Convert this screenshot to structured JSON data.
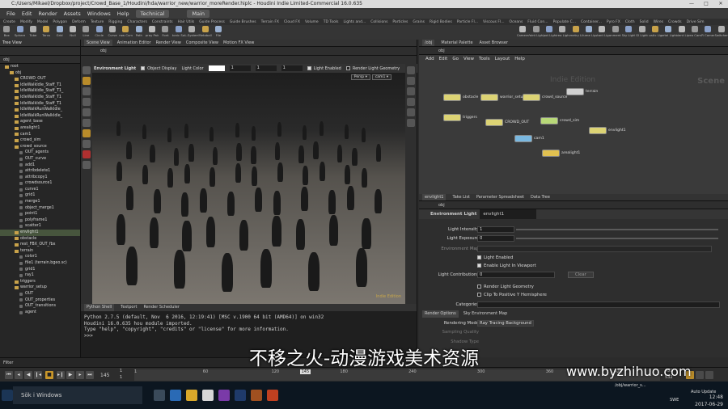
{
  "window": {
    "title": "C:/Users/Mikael/Dropbox/project/Crowd_Base_1/Houdini/hda/warrior_new/warrior_moreRender.hiplc - Houdini Indie Limited-Commercial 16.0.635",
    "controls": [
      "—",
      "□",
      "✕"
    ]
  },
  "menu": {
    "items": [
      "File",
      "Edit",
      "Render",
      "Assets",
      "Windows",
      "Help"
    ],
    "desktop": "Technical",
    "context": "Main"
  },
  "shelf": {
    "tabs": [
      "Create",
      "Modify",
      "Model",
      "Polygon",
      "Deform",
      "Texture",
      "Rigging",
      "Characters",
      "Constraints",
      "Hair Utils",
      "Guide Process",
      "Guide Brushes",
      "Terrain FX",
      "Cloud FX",
      "Volume",
      "TD Tools",
      "Lights and...",
      "Collisions",
      "Particles",
      "Grains",
      "Rigid Bodies",
      "Particle Fl...",
      "Viscous Fl...",
      "Oceans",
      "Fluid Con...",
      "Populate C...",
      "Container...",
      "Pyro FX",
      "Cloth",
      "Solid",
      "Wires",
      "Crowds",
      "Drive Sim"
    ],
    "tools": [
      "Box",
      "Sphere",
      "Tube",
      "Torus",
      "Grid",
      "Null",
      "Line",
      "Circle",
      "Curve",
      "Draw Curve",
      "Path",
      "Spray Paint",
      "Font",
      "Platonic Solids",
      "L-System",
      "Metaball",
      "File",
      "Camera",
      "Point Light",
      "Spot Light",
      "Area Light",
      "Geometry Light",
      "Volume Light",
      "Distant Light",
      "Environment Light",
      "Sky Light",
      "GI Light",
      "Caustic Light",
      "Portal Light",
      "Ambient Light",
      "Stereo Camera",
      "VR Camera",
      "Switcher"
    ]
  },
  "left": {
    "tab": "Tree View",
    "path": "obj",
    "tree": [
      "root",
      "obj",
      "CROWD_OUT",
      "IdleWalkIdle_Staff_T1",
      "IdleWalkIdle_Staff_T1_",
      "IdleWalkIdle_Staff_T1",
      "IdleWalkIdle_Staff_T1",
      "IdleWalkRunWalkIdle_",
      "IdleWalkRunWalkIdle_",
      "agent_base",
      "arealight1",
      "cam1",
      "crowd_sim",
      "crowd_source",
      "OUT_agents",
      "OUT_curve",
      "add1",
      "attribdelete1",
      "attribcopy1",
      "crowdsource1",
      "curve1",
      "grid1",
      "merge1",
      "object_merge1",
      "point1",
      "polyframe1",
      "scatter1",
      "envlight1",
      "obstacle",
      "rest_FBX_OUT_fbx",
      "terrain",
      "color1",
      "file1 (terrain.bgeo.sc)",
      "grid1",
      "ray1",
      "triggers",
      "warrior_setup",
      "OUT",
      "OUT_properties",
      "OUT_transitions",
      "agent"
    ],
    "filter": "Filter"
  },
  "viewer": {
    "tabs": [
      "Scene View",
      "Animation Editor",
      "Render View",
      "Composite View",
      "Motion FX View"
    ],
    "path": "obj",
    "node_type": "Environment Light",
    "object_display": "Object Display",
    "light_color": "Light Color",
    "color_vals": [
      "1",
      "1",
      "1"
    ],
    "light_enabled": "Light Enabled",
    "render_light_geo": "Render Light Geometry",
    "persp": "Persp ▾",
    "cam": "cam1 ▾",
    "edition": "Indie Edition"
  },
  "python": {
    "tabs": [
      "Python Shell",
      "Textport",
      "Render Scheduler"
    ],
    "lines": [
      "Python 2.7.5 (default, Nov  6 2016, 12:19:41) [MSC v.1900 64 bit (AMD64)] on win32",
      "Houdini 16.0.635 hou module imported.",
      "Type \"help\", \"copyright\", \"credits\" or \"license\" for more information.",
      ">>>"
    ]
  },
  "network": {
    "tabs": [
      "/obj",
      "Material Palette",
      "Asset Browser"
    ],
    "path": "obj",
    "menu": [
      "Add",
      "Edit",
      "Go",
      "View",
      "Tools",
      "Layout",
      "Help"
    ],
    "watermark": "Indie Edition",
    "context": "Scene",
    "nodes": [
      "obstacle",
      "warrior_setup",
      "crowd_source",
      "terrain",
      "triggers",
      "CROWD_OUT",
      "crowd_sim",
      "envlight1",
      "cam1",
      "arealight1"
    ]
  },
  "params": {
    "tabs": [
      "envlight1",
      "Take List",
      "Parameter Spreadsheet",
      "Data Tree"
    ],
    "path": "obj",
    "type": "Environment Light",
    "name": "envlight1",
    "intensity_label": "Light Intensity",
    "intensity": "1",
    "exposure_label": "Light Exposure",
    "exposure": "0",
    "env_map": "Environment Map",
    "light_enabled": "Light Enabled",
    "enable_viewport": "Enable Light In Viewport",
    "contrib_label": "Light Contributions",
    "contrib": "0",
    "clear": "Clear",
    "render_geo": "Render Light Geometry",
    "clip": "Clip To Positive Y Hemisphere",
    "categories": "Categories",
    "subtabs": [
      "Render Options",
      "Sky Environment Map"
    ],
    "render_mode_label": "Rendering Mode",
    "render_mode": "Ray Tracing Background",
    "sampling": "Sampling Quality",
    "shadow": "Shadow Type"
  },
  "timeline": {
    "frame": "145",
    "start": "1",
    "end": "451",
    "frame_end": "452",
    "range_end": "532",
    "ticks": [
      "1",
      "60",
      "120",
      "145",
      "180",
      "240",
      "300",
      "360",
      "420"
    ],
    "auto": "Auto Update"
  },
  "overlay": {
    "watermark": "不移之火-动漫游戏美术资源",
    "url": "www.byzhihuo.com"
  },
  "taskbar": {
    "search": "Sök i Windows",
    "time": "12:48",
    "date": "2017-06-29",
    "lang": "SWE",
    "window_label": "/obj/warrior_s..."
  }
}
